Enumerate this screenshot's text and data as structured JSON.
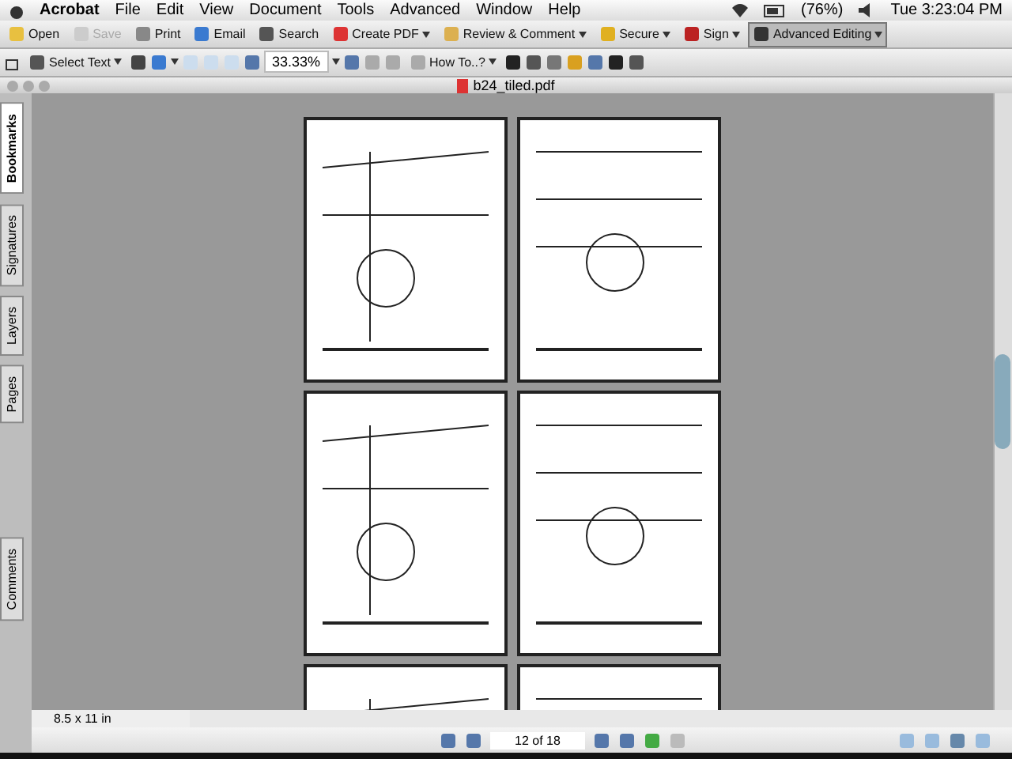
{
  "menu_bar": {
    "app": "Acrobat",
    "items": [
      "File",
      "Edit",
      "View",
      "Document",
      "Tools",
      "Advanced",
      "Window",
      "Help"
    ],
    "battery": "(76%)",
    "clock": "Tue 3:23:04 PM"
  },
  "toolbar": [
    {
      "label": "Open",
      "disabled": false,
      "dropdown": false,
      "selected": false
    },
    {
      "label": "Save",
      "disabled": true,
      "dropdown": false,
      "selected": false
    },
    {
      "label": "Print",
      "disabled": false,
      "dropdown": false,
      "selected": false
    },
    {
      "label": "Email",
      "disabled": false,
      "dropdown": false,
      "selected": false
    },
    {
      "label": "Search",
      "disabled": false,
      "dropdown": false,
      "selected": false
    },
    {
      "label": "Create PDF",
      "disabled": false,
      "dropdown": true,
      "selected": false
    },
    {
      "label": "Review & Comment",
      "disabled": false,
      "dropdown": true,
      "selected": false
    },
    {
      "label": "Secure",
      "disabled": false,
      "dropdown": true,
      "selected": false
    },
    {
      "label": "Sign",
      "disabled": false,
      "dropdown": true,
      "selected": false
    },
    {
      "label": "Advanced Editing",
      "disabled": false,
      "dropdown": true,
      "selected": true
    }
  ],
  "tool_bar_2": {
    "select_tool": "Select Text",
    "zoom": "33.33%",
    "how_to": "How To..?"
  },
  "window": {
    "title": "b24_tiled.pdf"
  },
  "side_tabs": [
    {
      "label": "Bookmarks",
      "selected": true
    },
    {
      "label": "Signatures",
      "selected": false
    },
    {
      "label": "Layers",
      "selected": false
    },
    {
      "label": "Pages",
      "selected": false
    },
    {
      "label": "Comments",
      "selected": false
    }
  ],
  "status": {
    "page_size": "8.5 x 11 in",
    "page_field": "12 of 18"
  }
}
